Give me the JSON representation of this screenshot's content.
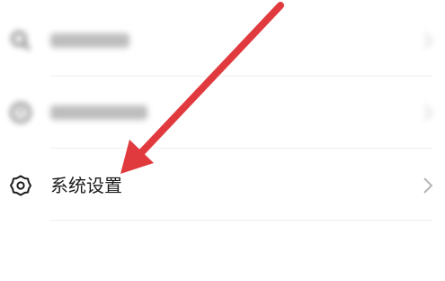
{
  "settings_menu": {
    "items": [
      {
        "label": "",
        "icon": "search-icon",
        "blurred": true
      },
      {
        "label": "",
        "icon": "info-icon",
        "blurred": true
      },
      {
        "label": "系统设置",
        "icon": "gear-icon",
        "blurred": false
      }
    ]
  },
  "annotation": {
    "arrow_color": "#e03a3e"
  }
}
